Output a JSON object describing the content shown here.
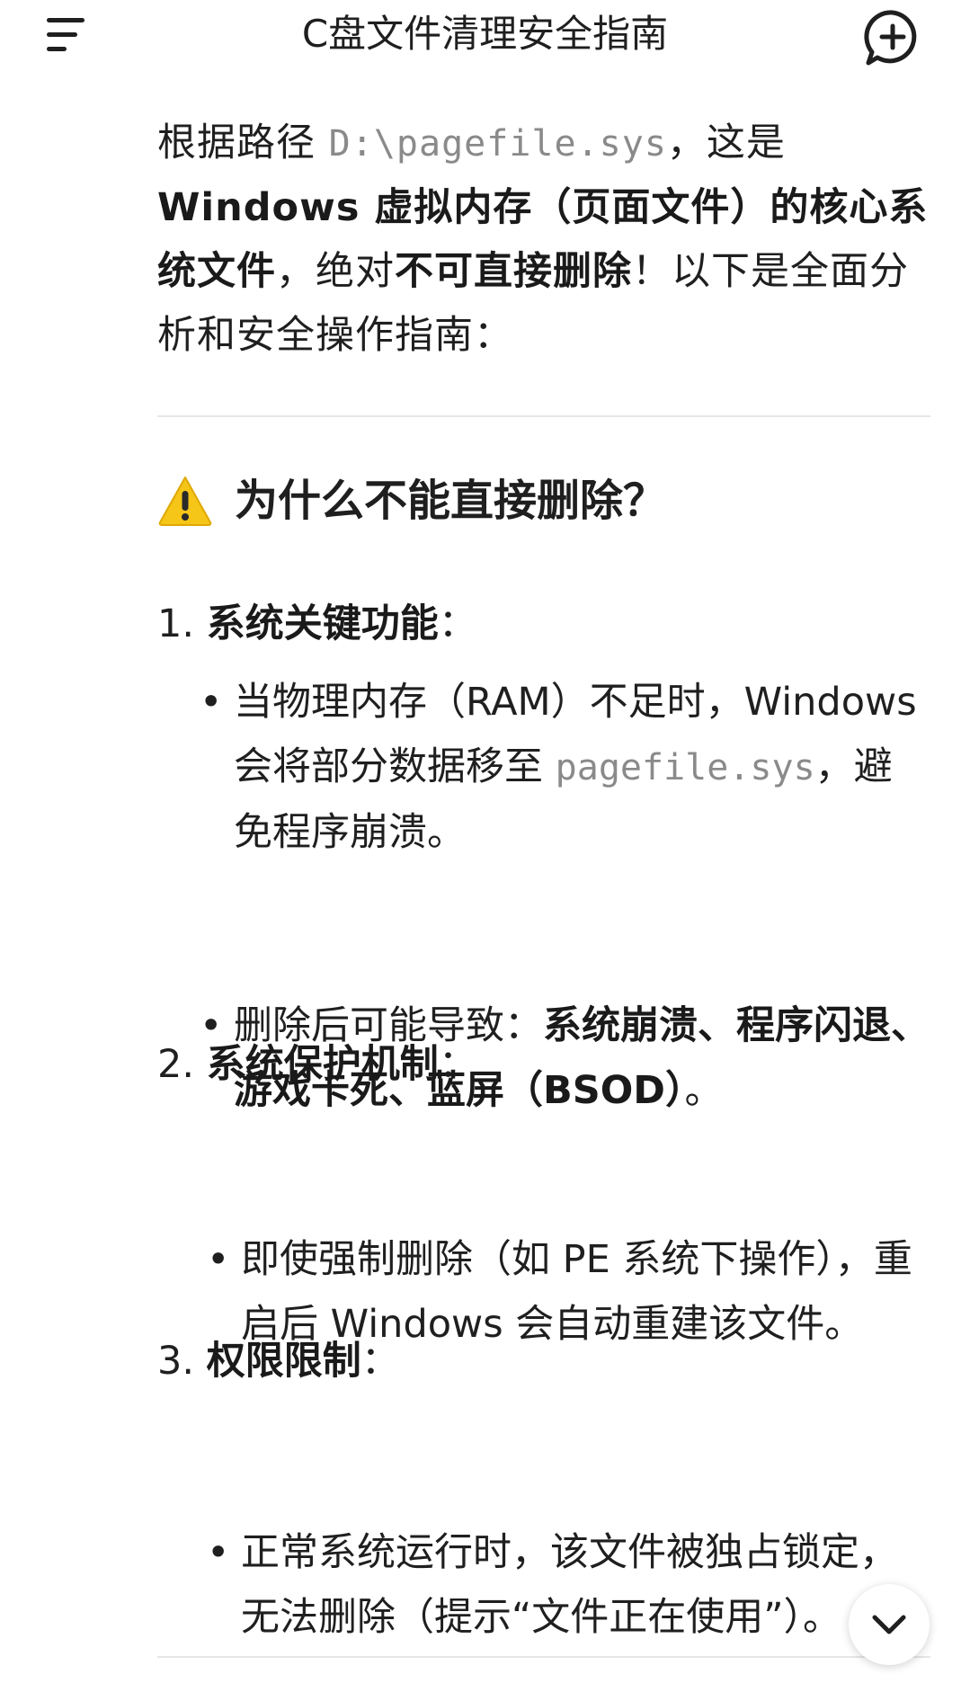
{
  "header": {
    "title": "C盘文件清理安全指南",
    "menu_icon": "menu-icon",
    "new_chat_icon": "new-chat-icon"
  },
  "intro": {
    "prefix": "根据路径 ",
    "path": "D:\\pagefile.sys",
    "after_path": "，这是 ",
    "bold_1": "Windows 虚拟内存（页面文件）的核心系统文件",
    "middle": "，绝对",
    "bold_2": "不可直接删除",
    "suffix": "！以下是全面分析和安全操作指南："
  },
  "section": {
    "heading_icon": "warning-icon",
    "heading": "为什么不能直接删除？",
    "items": [
      {
        "number": "1.",
        "title": "系统关键功能",
        "colon": "：",
        "bullets": [
          {
            "text_1": "当物理内存（RAM）不足时，Windows 会将部分数据移至 ",
            "code": "pagefile.sys",
            "text_2": "，避免程序崩溃。"
          },
          {
            "text_1": "删除后可能导致：",
            "bold": "系统崩溃、程序闪退、游戏卡死、蓝屏（BSOD）",
            "text_2": "。"
          }
        ]
      },
      {
        "number": "2.",
        "title": "系统保护机制",
        "colon": "：",
        "bullets": [
          {
            "text_1": "即使强制删除（如 PE 系统下操作），重启后 Windows 会自动重建该文件。"
          }
        ]
      },
      {
        "number": "3.",
        "title": "权限限制",
        "colon": "：",
        "bullets": [
          {
            "text_1": "正常系统运行时，该文件被独占锁定，无法删除（提示“文件正在使用”）。"
          }
        ]
      }
    ]
  },
  "scroll_button_icon": "chevron-down-icon"
}
